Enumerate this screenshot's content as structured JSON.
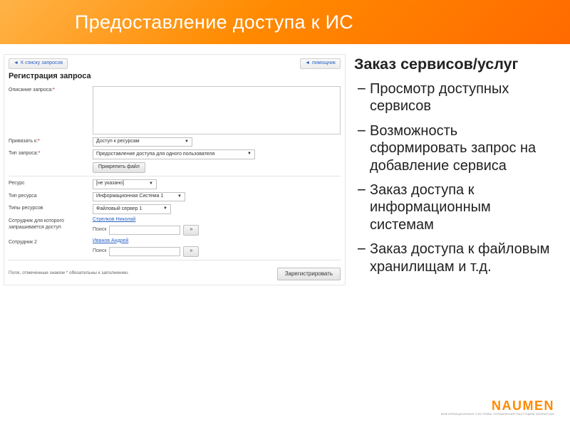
{
  "title": "Предоставление доступа к ИС",
  "screenshot": {
    "top_left_btn": "К списку запросов",
    "top_right_btn": "помощник",
    "heading": "Регистрация запроса",
    "desc_label": "Описание запроса:",
    "bind_label": "Привязать к:",
    "bind_value": "Доступ к ресурсам",
    "type_label": "Тип запроса:",
    "type_value": "Предоставление доступа для одного пользователя",
    "attach_btn": "Прикрепить файл",
    "resource_label": "Ресурс",
    "resource_value": "[не указано]",
    "restype_label": "Тип ресурса",
    "restype_value": "Информационная Система 1",
    "restypes_label": "Типы ресурсов",
    "restypes_value": "Файловый сервер 1",
    "emp_label": "Сотрудник для которого запрашивается доступ",
    "emp_value": "Стрелков Николай",
    "search_label": "Поиск",
    "emp2_label": "Сотрудник 2",
    "emp2_value": "Иванов Андрей",
    "note": "Поля, отмеченные знаком * обязательны к заполнению.",
    "submit": "Зарегистрировать"
  },
  "right": {
    "heading": "Заказ сервисов/услуг",
    "bullets": [
      "Просмотр доступных сервисов",
      "Возможность сформировать запрос на добавление сервиса",
      "Заказ доступа к информационным системам",
      "Заказ доступа к файловым хранилищам и т.д."
    ]
  },
  "logo": {
    "name": "NAUMEN",
    "tagline": "ИНФОРМАЦИОННЫЕ СИСТЕМЫ УПРАВЛЕНИЯ РАСТУЩИМ БИЗНЕСОМ"
  }
}
